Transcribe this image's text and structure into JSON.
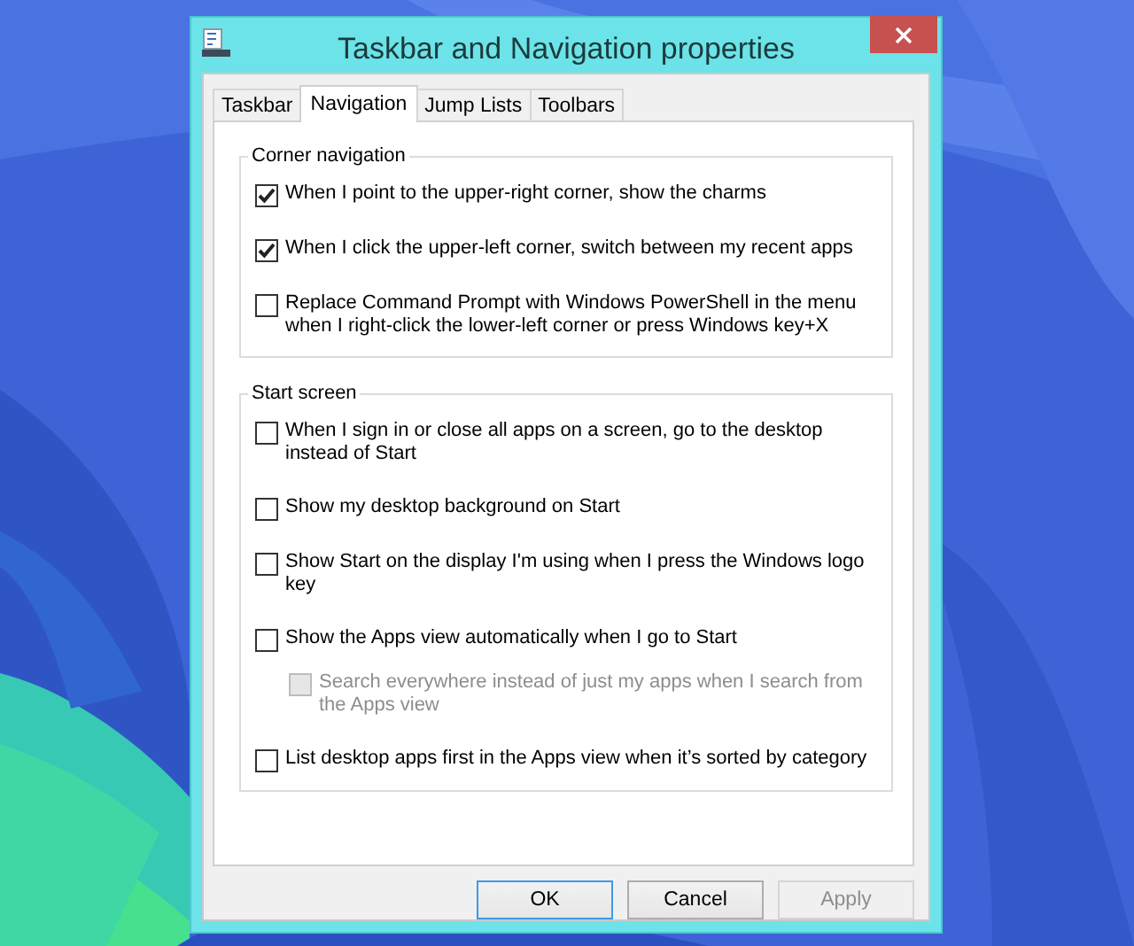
{
  "window": {
    "title": "Taskbar and Navigation properties"
  },
  "tabs": [
    {
      "label": "Taskbar",
      "selected": false
    },
    {
      "label": "Navigation",
      "selected": true
    },
    {
      "label": "Jump Lists",
      "selected": false
    },
    {
      "label": "Toolbars",
      "selected": false
    }
  ],
  "groups": [
    {
      "title": "Corner navigation",
      "options": [
        {
          "label": "When I point to the upper-right corner, show the charms",
          "checked": true,
          "disabled": false
        },
        {
          "label": "When I click the upper-left corner, switch between my recent apps",
          "checked": true,
          "disabled": false
        },
        {
          "label": "Replace Command Prompt with Windows PowerShell in the menu when I right-click the lower-left corner or press Windows key+X",
          "checked": false,
          "disabled": false
        }
      ]
    },
    {
      "title": "Start screen",
      "options": [
        {
          "label": "When I sign in or close all apps on a screen, go to the desktop instead of Start",
          "checked": false,
          "disabled": false
        },
        {
          "label": "Show my desktop background on Start",
          "checked": false,
          "disabled": false
        },
        {
          "label": "Show Start on the display I'm using when I press the Windows logo key",
          "checked": false,
          "disabled": false
        },
        {
          "label": "Show the Apps view automatically when I go to Start",
          "checked": false,
          "disabled": false,
          "children": [
            {
              "label": "Search everywhere instead of just my apps when I search from the Apps view",
              "checked": false,
              "disabled": true
            }
          ]
        },
        {
          "label": "List desktop apps first in the Apps view when it’s sorted by category",
          "checked": false,
          "disabled": false
        }
      ]
    }
  ],
  "buttons": [
    {
      "label": "OK",
      "default": true,
      "disabled": false
    },
    {
      "label": "Cancel",
      "default": false,
      "disabled": false
    },
    {
      "label": "Apply",
      "default": false,
      "disabled": true
    }
  ]
}
